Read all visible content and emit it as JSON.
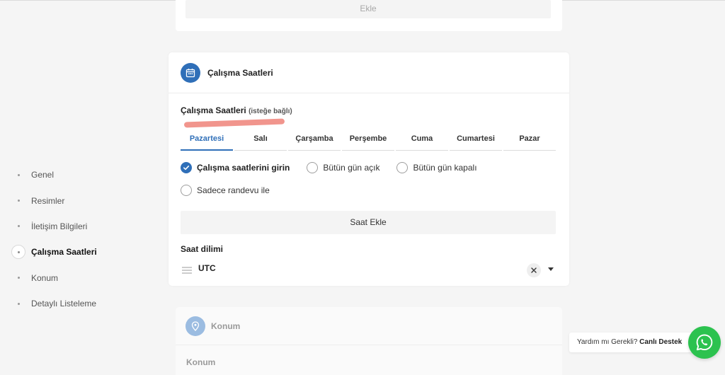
{
  "top_card": {
    "add_label": "Ekle"
  },
  "sidebar": {
    "items": [
      {
        "label": "Genel"
      },
      {
        "label": "Resimler"
      },
      {
        "label": "İletişim Bilgileri"
      },
      {
        "label": "Çalışma Saatleri"
      },
      {
        "label": "Konum"
      },
      {
        "label": "Detaylı Listeleme"
      }
    ],
    "active": "Çalışma Saatleri"
  },
  "hours_card": {
    "title": "Çalışma Saatleri",
    "field_label": "Çalışma Saatleri",
    "field_optional": "(isteğe bağlı)",
    "tabs": [
      {
        "label": "Pazartesi"
      },
      {
        "label": "Salı"
      },
      {
        "label": "Çarşamba"
      },
      {
        "label": "Perşembe"
      },
      {
        "label": "Cuma"
      },
      {
        "label": "Cumartesi"
      },
      {
        "label": "Pazar"
      }
    ],
    "active_tab": "Pazartesi",
    "options": [
      {
        "label": "Çalışma saatlerini girin"
      },
      {
        "label": "Bütün gün açık"
      },
      {
        "label": "Bütün gün kapalı"
      },
      {
        "label": "Sadece randevu ile"
      }
    ],
    "selected_option": "Çalışma saatlerini girin",
    "add_hours_label": "Saat Ekle",
    "timezone_label": "Saat dilimi",
    "timezone_value": "UTC"
  },
  "location_card": {
    "title": "Konum",
    "field_label": "Konum"
  },
  "support": {
    "question": "Yardım mı Gerekli?",
    "link": "Canlı Destek"
  },
  "colors": {
    "accent": "#2f6fb8",
    "whatsapp": "#2cc24f",
    "annotation_red": "#f08f87"
  }
}
